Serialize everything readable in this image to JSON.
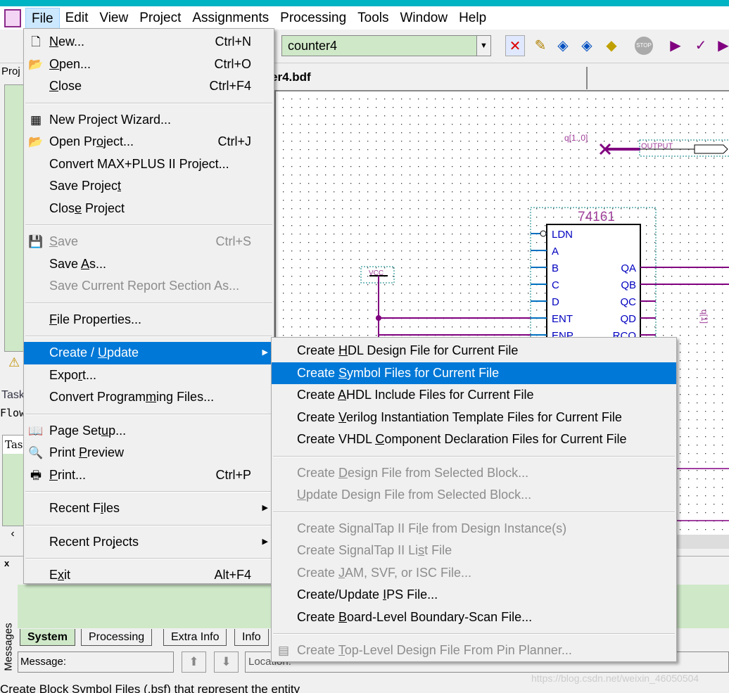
{
  "menubar": [
    "File",
    "Edit",
    "View",
    "Project",
    "Assignments",
    "Processing",
    "Tools",
    "Window",
    "Help"
  ],
  "toolbar": {
    "entity": "counter4",
    "stop_label": "STOP"
  },
  "document_tab": "er4.bdf",
  "left_pane": {
    "project_label": "Proj",
    "tasks_label": "Task",
    "flow_label": "Flow",
    "task_col": "Tas"
  },
  "schematic": {
    "bus_label": "q[1..0]",
    "output_label": "OUTPUT",
    "vcc_label": "VCC",
    "chip_name": "74161",
    "inputs": [
      "LDN",
      "A",
      "B",
      "C",
      "D",
      "ENT",
      "ENP"
    ],
    "outputs": [
      "QA",
      "QB",
      "QC",
      "QD",
      "RCO"
    ],
    "net_label": "q[1]",
    "colors": {
      "wire": "#800080",
      "pin": "#0070c0",
      "label": "#0000c0"
    }
  },
  "file_menu": [
    {
      "label": "New...",
      "mn": 0,
      "shortcut": "Ctrl+N",
      "icon": "new-file"
    },
    {
      "label": "Open...",
      "mn": 0,
      "shortcut": "Ctrl+O",
      "icon": "open-folder"
    },
    {
      "label": "Close",
      "mn": 0,
      "shortcut": "Ctrl+F4"
    },
    {
      "sep": true
    },
    {
      "label": "New Project Wizard...",
      "mn": -1,
      "icon": "wizard"
    },
    {
      "label": "Open Project...",
      "mn": 7,
      "shortcut": "Ctrl+J",
      "icon": "open-project"
    },
    {
      "label": "Convert MAX+PLUS II Project...",
      "mn": -1
    },
    {
      "label": "Save Project",
      "mn": 11
    },
    {
      "label": "Close Project",
      "mn": 4
    },
    {
      "sep": true
    },
    {
      "label": "Save",
      "mn": 0,
      "shortcut": "Ctrl+S",
      "disabled": true,
      "icon": "save"
    },
    {
      "label": "Save As...",
      "mn": 5
    },
    {
      "label": "Save Current Report Section As...",
      "mn": -1,
      "disabled": true
    },
    {
      "sep": true
    },
    {
      "label": "File Properties...",
      "mn": 0
    },
    {
      "sep": true
    },
    {
      "label": "Create / Update",
      "mn": 9,
      "submenu": true,
      "highlighted": true
    },
    {
      "label": "Export...",
      "mn": 4
    },
    {
      "label": "Convert Programming Files...",
      "mn": 15
    },
    {
      "sep": true
    },
    {
      "label": "Page Setup...",
      "mn": 8,
      "icon": "book"
    },
    {
      "label": "Print Preview",
      "mn": 6,
      "icon": "print-preview"
    },
    {
      "label": "Print...",
      "mn": 0,
      "shortcut": "Ctrl+P",
      "icon": "printer"
    },
    {
      "sep": true
    },
    {
      "label": "Recent Files",
      "mn": 8,
      "submenu": true
    },
    {
      "sep": true
    },
    {
      "label": "Recent Projects",
      "mn": 10,
      "submenu": true
    },
    {
      "sep": true
    },
    {
      "label": "Exit",
      "mn": 1,
      "shortcut": "Alt+F4"
    }
  ],
  "create_update_menu": [
    {
      "label": "Create HDL Design File for Current File",
      "mn": 7
    },
    {
      "label": "Create Symbol Files for Current File",
      "mn": 7,
      "highlighted": true
    },
    {
      "label": "Create AHDL Include Files for Current File",
      "mn": 7
    },
    {
      "label": "Create Verilog Instantiation Template Files for Current File",
      "mn": 7
    },
    {
      "label": "Create VHDL Component Declaration Files for Current File",
      "mn": 12
    },
    {
      "sep": true
    },
    {
      "label": "Create Design File from Selected Block...",
      "mn": 7,
      "disabled": true
    },
    {
      "label": "Update Design File from Selected Block...",
      "mn": 0,
      "disabled": true
    },
    {
      "sep": true
    },
    {
      "label": "Create SignalTap II File from Design Instance(s)",
      "mn": 22,
      "disabled": true
    },
    {
      "label": "Create SignalTap II List File",
      "mn": 22,
      "disabled": true
    },
    {
      "label": "Create JAM, SVF, or ISC File...",
      "mn": 7,
      "disabled": true
    },
    {
      "label": "Create/Update IPS File...",
      "mn": 14
    },
    {
      "label": "Create Board-Level Boundary-Scan File...",
      "mn": 7
    },
    {
      "sep": true
    },
    {
      "label": "Create Top-Level Design File From Pin Planner...",
      "mn": 7,
      "disabled": true,
      "icon": "pin-planner"
    }
  ],
  "messages": {
    "panel_title": "Messages",
    "tabs": [
      "System",
      "Processing",
      "Extra Info",
      "Info"
    ],
    "message_label": "Message:",
    "location_label": "Location:"
  },
  "status_bar": "Create Block Symbol Files (.bsf) that represent the entity",
  "watermark": "https://blog.csdn.net/weixin_46050504"
}
